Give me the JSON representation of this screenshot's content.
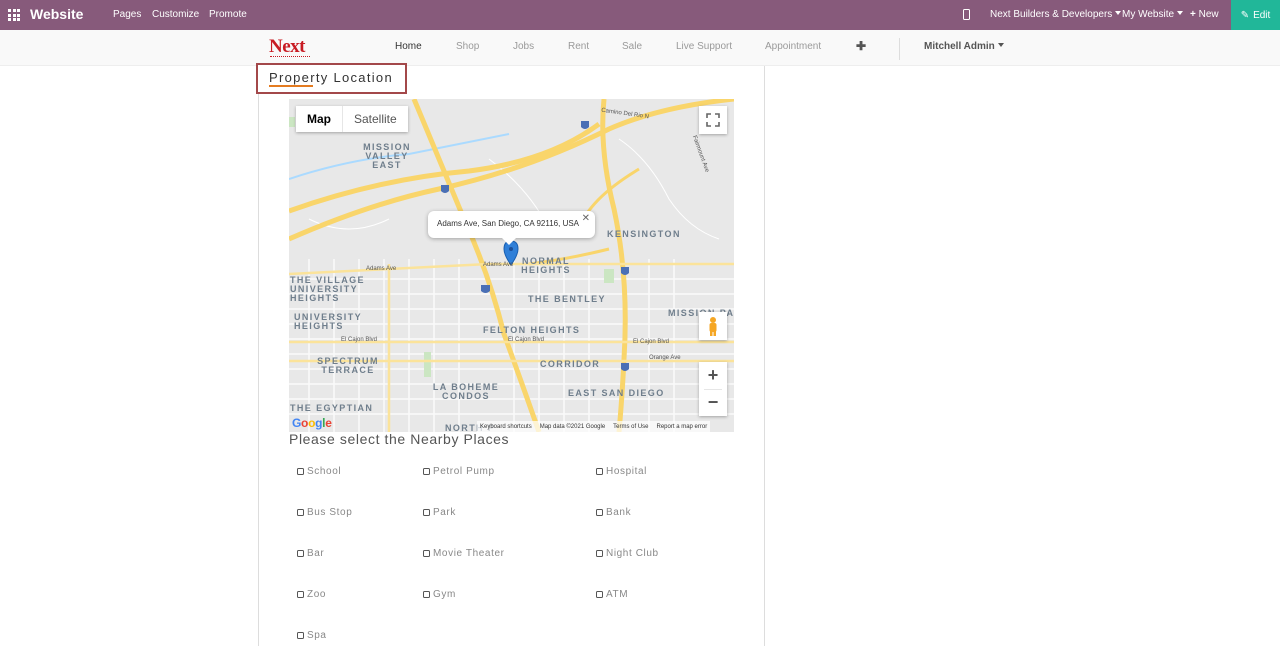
{
  "topbar": {
    "brand": "Website",
    "menu": [
      "Pages",
      "Customize",
      "Promote"
    ],
    "company": "Next Builders & Developers",
    "website": "My Website",
    "new_label": "New",
    "edit_label": "Edit"
  },
  "header": {
    "logo": "Next",
    "nav": [
      "Home",
      "Shop",
      "Jobs",
      "Rent",
      "Sale",
      "Live Support",
      "Appointment"
    ],
    "user": "Mitchell Admin"
  },
  "section": {
    "heading": "Property Location"
  },
  "map": {
    "type_map": "Map",
    "type_satellite": "Satellite",
    "infowindow": "Adams Ave, San Diego, CA 92116, USA",
    "zoom_in": "+",
    "zoom_out": "−",
    "footer": [
      "Keyboard shortcuts",
      "Map data ©2021 Google",
      "Terms of Use",
      "Report a map error"
    ],
    "google": "Google",
    "areas": [
      "MISSION VALLEY EAST",
      "KENSINGTON",
      "NORMAL HEIGHTS",
      "THE VILLAGE UNIVERSITY HEIGHTS",
      "UNIVERSITY HEIGHTS",
      "THE BENTLEY",
      "MISSION PACIFIC",
      "FELTON HEIGHTS",
      "SPECTRUM TERRACE",
      "CORRIDOR",
      "LA BOHEME CONDOS",
      "EAST SAN DIEGO",
      "THE EGYPTIAN",
      "NORTH P"
    ],
    "streets": [
      "Camino Del Rio N",
      "Adams Ave",
      "Adams Ave",
      "El Cajon Blvd",
      "El Cajon Blvd",
      "El Cajon Blvd",
      "Orange Ave",
      "Fairmount Ave"
    ]
  },
  "nearby": {
    "title": "Please select the Nearby Places",
    "places": [
      "School",
      "Petrol Pump",
      "Hospital",
      "Bus Stop",
      "Park",
      "Bank",
      "Bar",
      "Movie Theater",
      "Night Club",
      "Zoo",
      "Gym",
      "ATM",
      "Spa"
    ]
  }
}
